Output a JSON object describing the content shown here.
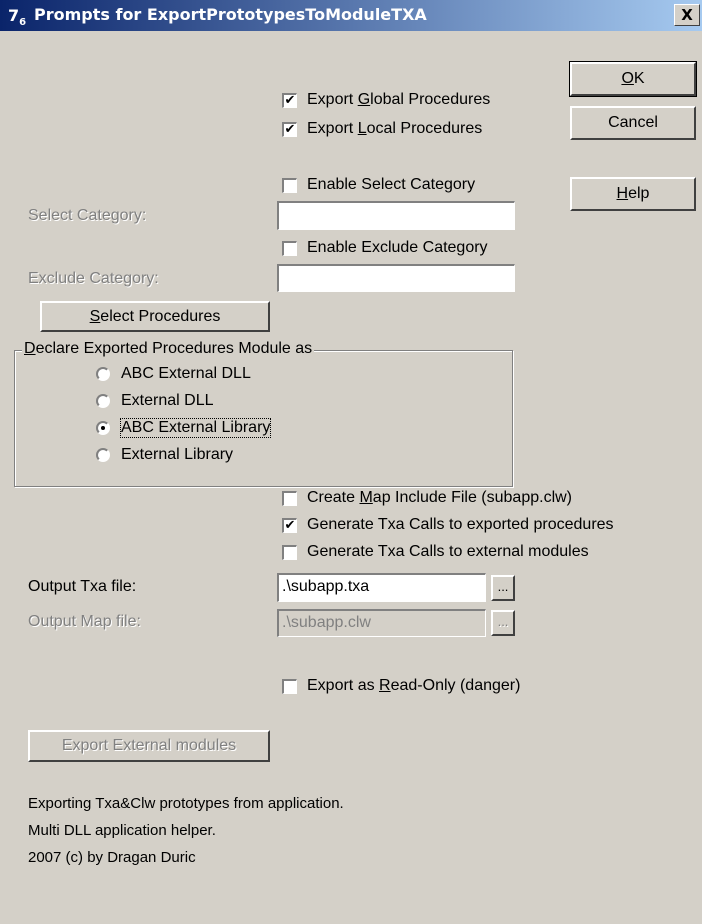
{
  "window": {
    "icon_text": "7",
    "icon_sub": "6",
    "title": "Prompts for ExportPrototypesToModuleTXA",
    "close_label": "X"
  },
  "buttons": {
    "ok": {
      "pre": "",
      "key": "O",
      "post": "K"
    },
    "cancel": "Cancel",
    "help": {
      "pre": "",
      "key": "H",
      "post": "elp"
    },
    "select_procedures": {
      "pre": "",
      "key": "S",
      "post": "elect Procedures"
    },
    "export_external_modules": "Export External modules",
    "browse_txa": "...",
    "browse_map": "..."
  },
  "checkboxes": {
    "export_global": {
      "pre": "Export ",
      "key": "G",
      "post": "lobal Procedures",
      "checked": true
    },
    "export_local": {
      "pre": "Export ",
      "key": "L",
      "post": "ocal Procedures",
      "checked": true
    },
    "enable_select": {
      "label": "Enable Select Category",
      "checked": false
    },
    "enable_exclude": {
      "label": "Enable Exclude Category",
      "checked": false
    },
    "create_map": {
      "pre": "Create ",
      "key": "M",
      "post": "ap Include File (subapp.clw)",
      "checked": false
    },
    "gen_txa_exported": {
      "label": "Generate Txa Calls to exported procedures",
      "checked": true
    },
    "gen_txa_external": {
      "label": "Generate Txa Calls to external modules",
      "checked": false
    },
    "read_only": {
      "pre": "Export as ",
      "key": "R",
      "post": "ead-Only (danger)",
      "checked": false
    }
  },
  "fields": {
    "select_category": {
      "label": "Select Category:",
      "value": ""
    },
    "exclude_category": {
      "label": "Exclude Category:",
      "value": ""
    },
    "output_txa": {
      "label": "Output Txa file:",
      "value": ".\\subapp.txa"
    },
    "output_map": {
      "label": "Output Map file:",
      "value": ".\\subapp.clw"
    }
  },
  "group": {
    "legend_key": "D",
    "legend_rest": "eclare Exported Procedures Module as",
    "options": [
      {
        "label": "ABC External DLL",
        "selected": false
      },
      {
        "label": "External DLL",
        "selected": false
      },
      {
        "label": "ABC External Library",
        "selected": true
      },
      {
        "label": "External Library",
        "selected": false
      }
    ]
  },
  "info": {
    "line1": "Exporting Txa&Clw prototypes from application.",
    "line2": "Multi DLL application helper.",
    "line3": "2007 (c) by Dragan Duric"
  }
}
